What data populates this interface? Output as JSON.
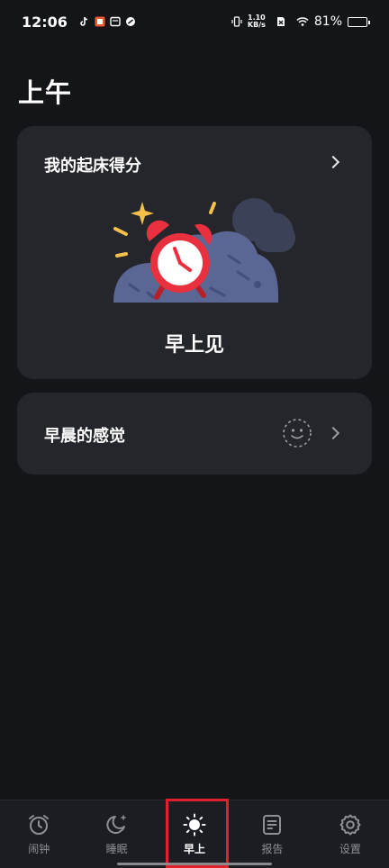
{
  "status_bar": {
    "time": "12:06",
    "net_speed_value": "1.10",
    "net_speed_unit": "KB/s",
    "battery_percent": "81%",
    "battery_level": 0.81
  },
  "page": {
    "title": "上午"
  },
  "score_card": {
    "title": "我的起床得分",
    "message": "早上见"
  },
  "feeling_card": {
    "title": "早晨的感觉"
  },
  "bottom_nav": {
    "items": [
      {
        "label": "闹钟",
        "icon": "alarm-clock-icon"
      },
      {
        "label": "睡眠",
        "icon": "moon-icon"
      },
      {
        "label": "早上",
        "icon": "sun-icon",
        "active": true
      },
      {
        "label": "报告",
        "icon": "report-icon"
      },
      {
        "label": "设置",
        "icon": "gear-icon"
      }
    ]
  },
  "colors": {
    "background": "#141518",
    "card": "#24262b",
    "alarm_red": "#e8303f",
    "cloud": "#5a6694",
    "highlight": "#e0202a"
  }
}
